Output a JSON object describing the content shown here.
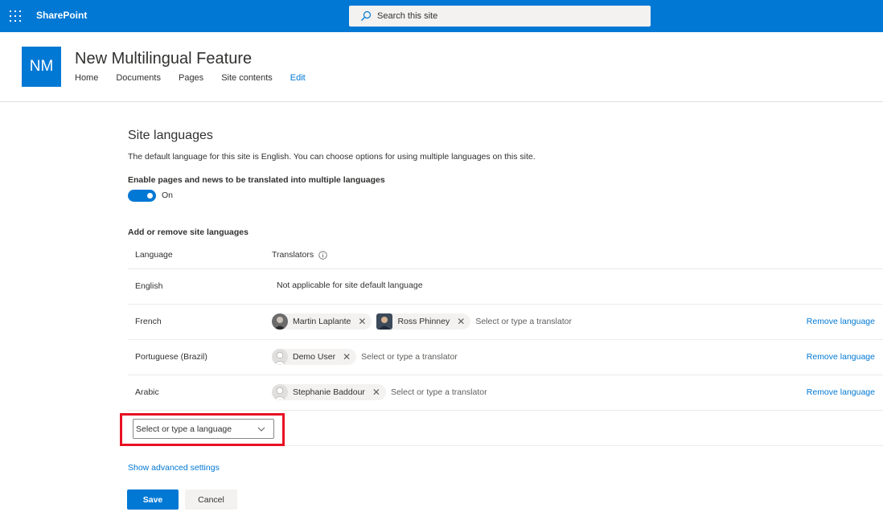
{
  "suitebar": {
    "app_name": "SharePoint",
    "search_placeholder": "Search this site",
    "accent": "#0078d4"
  },
  "site": {
    "logo_text": "NM",
    "title": "New Multilingual Feature",
    "nav": [
      "Home",
      "Documents",
      "Pages",
      "Site contents"
    ],
    "edit_label": "Edit"
  },
  "languages_page": {
    "heading": "Site languages",
    "description": "The default language for this site is English. You can choose options for using multiple languages on this site.",
    "toggle_label": "Enable pages and news to be translated into multiple languages",
    "toggle_state": "On",
    "section_label": "Add or remove site languages",
    "table": {
      "col_language": "Language",
      "col_translators": "Translators",
      "default_row": {
        "language": "English",
        "note": "Not applicable for site default language"
      },
      "rows": [
        {
          "language": "French",
          "translators": [
            "Martin Laplante",
            "Ross Phinney"
          ],
          "placeholder": "Select or type a translator",
          "remove": "Remove language"
        },
        {
          "language": "Portuguese (Brazil)",
          "translators": [
            "Demo User"
          ],
          "placeholder": "Select or type a translator",
          "remove": "Remove language"
        },
        {
          "language": "Arabic",
          "translators": [
            "Stephanie Baddour"
          ],
          "placeholder": "Select or type a translator",
          "remove": "Remove language"
        }
      ],
      "add_language_placeholder": "Select or type a language"
    },
    "advanced_link": "Show advanced settings",
    "save": "Save",
    "cancel": "Cancel"
  },
  "icons": {
    "waffle": "app-launcher-icon",
    "search": "search-icon",
    "info": "info-icon",
    "dropdown": "chevron-down-icon",
    "remove": "close-icon"
  }
}
